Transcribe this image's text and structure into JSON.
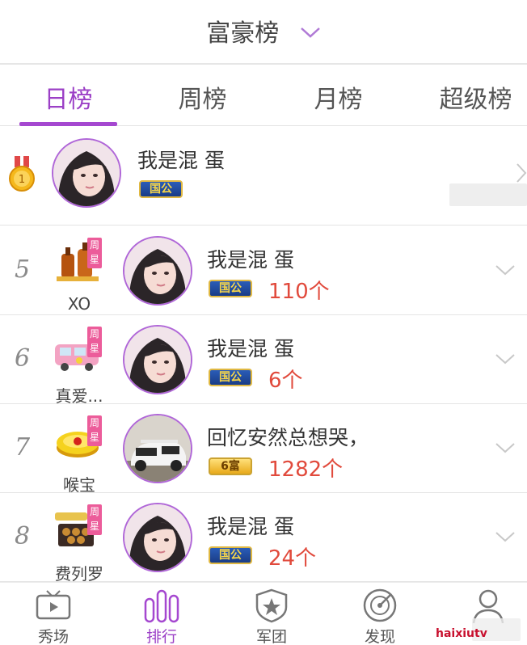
{
  "header": {
    "title": "富豪榜"
  },
  "tabs": [
    {
      "label": "日榜"
    },
    {
      "label": "周榜"
    },
    {
      "label": "月榜"
    },
    {
      "label": "超级榜"
    }
  ],
  "top_entry": {
    "name": "我是混 蛋",
    "badge": "国公"
  },
  "rows": [
    {
      "rank": "5",
      "gift_label": "XO",
      "week_star": "周星",
      "name": "我是混 蛋",
      "badge": "国公",
      "count": "110个"
    },
    {
      "rank": "6",
      "gift_label": "真爱...",
      "week_star": "周星",
      "name": "我是混 蛋",
      "badge": "国公",
      "count": "6个"
    },
    {
      "rank": "7",
      "gift_label": "喉宝",
      "week_star": "周星",
      "name": "回忆安然总想哭，",
      "badge": "6富",
      "count": "1282个"
    },
    {
      "rank": "8",
      "gift_label": "费列罗",
      "week_star": "周星",
      "name": "我是混 蛋",
      "badge": "国公",
      "count": "24个"
    }
  ],
  "tabbar": [
    {
      "label": "秀场",
      "icon": "tv-icon"
    },
    {
      "label": "排行",
      "icon": "ranking-bars-icon"
    },
    {
      "label": "军团",
      "icon": "shield-star-icon"
    },
    {
      "label": "发现",
      "icon": "radar-icon"
    },
    {
      "label": "",
      "icon": "user-icon"
    }
  ],
  "watermark": "haixiutv",
  "colors": {
    "accent": "#9b3fc6",
    "count_red": "#e14a3c",
    "badge_blue": "#2a5db8",
    "badge_gold": "#e8a91a"
  }
}
